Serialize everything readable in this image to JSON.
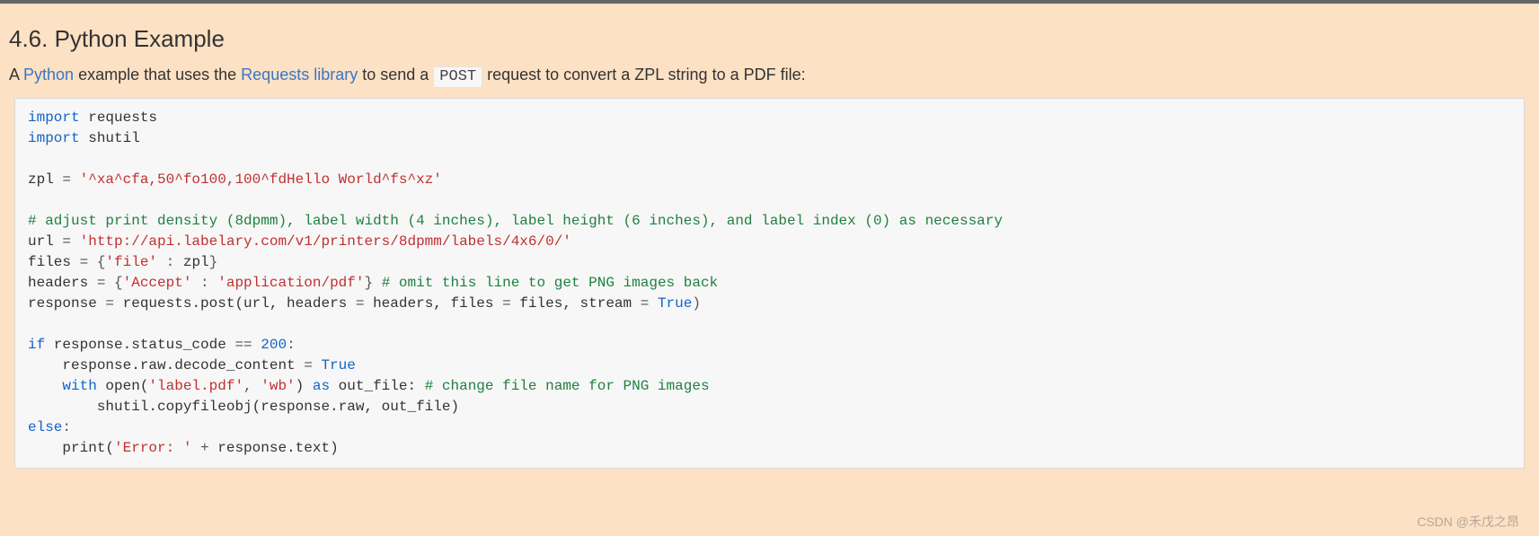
{
  "heading": "4.6. Python Example",
  "intro": {
    "t1": "A ",
    "link_python": "Python",
    "t2": " example that uses the ",
    "link_requests": "Requests library",
    "t3": " to send a ",
    "code_post": "POST",
    "t4": " request to convert a ZPL string to a PDF file:"
  },
  "code": {
    "kw_import1": "import",
    "id_requests": " requests",
    "kw_import2": "import",
    "id_shutil": " shutil",
    "id_zpl": "zpl ",
    "op_eq1": "= ",
    "str_zpl": "'^xa^cfa,50^fo100,100^fdHello World^fs^xz'",
    "cmt_adjust": "# adjust print density (8dpmm), label width (4 inches), label height (6 inches), and label index (0) as necessary",
    "id_url": "url ",
    "op_eq2": "= ",
    "str_url": "'http://api.labelary.com/v1/printers/8dpmm/labels/4x6/0/'",
    "id_files": "files ",
    "op_eq3": "= ",
    "op_lbrace1": "{",
    "str_filekey": "'file'",
    "op_colon1": " : ",
    "id_zplref": "zpl",
    "op_rbrace1": "}",
    "id_headers": "headers ",
    "op_eq4": "= ",
    "op_lbrace2": "{",
    "str_accept": "'Accept'",
    "op_colon2": " : ",
    "str_apppdf": "'application/pdf'",
    "op_rbrace2": "} ",
    "cmt_omit": "# omit this line to get PNG images back",
    "id_response": "response ",
    "op_eq5": "= ",
    "id_reqpost": "requests.post(url, headers ",
    "op_eq6": "= ",
    "id_headersref": "headers, files ",
    "op_eq7": "= ",
    "id_filesref": "files, stream ",
    "op_eq8": "= ",
    "kw_true1": "True",
    "op_paren1": ")",
    "kw_if": "if",
    "id_status": " response.status_code ",
    "op_eqeq": "== ",
    "num_200": "200",
    "op_colon3": ":",
    "indent1": "    ",
    "id_raw": "response.raw.decode_content ",
    "op_eq9": "= ",
    "kw_true2": "True",
    "kw_with": "with",
    "id_open": " open(",
    "str_labelpdf": "'label.pdf'",
    "op_comma": ", ",
    "str_wb": "'wb'",
    "id_closeparen": ") ",
    "kw_as": "as",
    "id_outfile": " out_file: ",
    "cmt_change": "# change file name for PNG images",
    "indent2": "        ",
    "id_copy": "shutil.copyfileobj(response.raw, out_file)",
    "kw_else": "else",
    "op_colon4": ":",
    "id_print": "print(",
    "str_error": "'Error: '",
    "op_plus": " + ",
    "id_resptext": "response.text)"
  },
  "watermark": "CSDN @禾戊之昂"
}
